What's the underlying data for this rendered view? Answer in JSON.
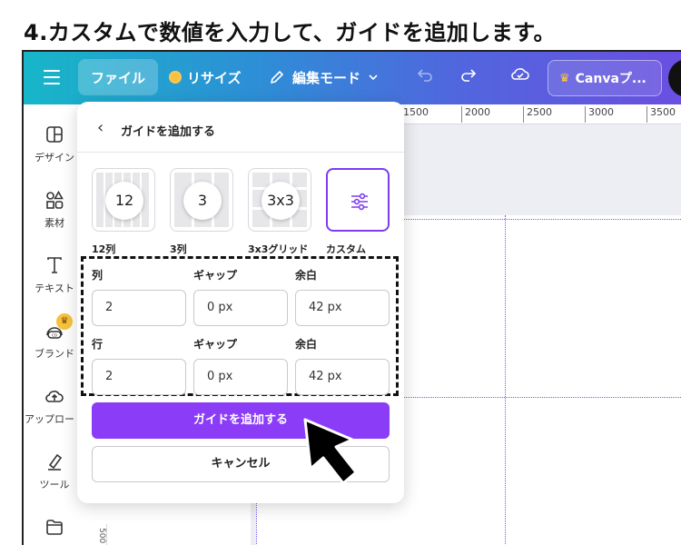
{
  "step": {
    "title": "4.カスタムで数値を入力して、ガイドを追加します。"
  },
  "topbar": {
    "file_label": "ファイル",
    "resize_label": "リサイズ",
    "edit_label": "編集モード",
    "canva_label": "Canvaプ..."
  },
  "sidebar": {
    "items": [
      {
        "label": "デザイン",
        "icon": "layout-icon"
      },
      {
        "label": "素材",
        "icon": "shapes-icon"
      },
      {
        "label": "テキスト",
        "icon": "text-icon"
      },
      {
        "label": "ブランド",
        "icon": "brand-icon"
      },
      {
        "label": "アップロード",
        "icon": "upload-icon"
      },
      {
        "label": "ツール",
        "icon": "tool-icon"
      },
      {
        "label": "",
        "icon": "folder-icon"
      }
    ]
  },
  "ruler": {
    "ticks": [
      "1500",
      "2000",
      "2500",
      "3000",
      "3500"
    ],
    "vertical_tick": "500"
  },
  "dialog": {
    "title": "ガイドを追加する",
    "presets": [
      {
        "badge": "12",
        "label": "12列"
      },
      {
        "badge": "3",
        "label": "3列"
      },
      {
        "badge": "3x3",
        "label": "3x3グリッド"
      },
      {
        "badge": "",
        "label": "カスタム"
      }
    ],
    "selected_preset": "カスタム",
    "columns": {
      "label": "列",
      "gap_label": "ギャップ",
      "margin_label": "余白",
      "value": "2",
      "gap": "0 px",
      "margin": "42 px"
    },
    "rows": {
      "label": "行",
      "gap_label": "ギャップ",
      "margin_label": "余白",
      "value": "2",
      "gap": "0 px",
      "margin": "42 px"
    },
    "add_button": "ガイドを追加する",
    "cancel_button": "キャンセル"
  },
  "colors": {
    "accent": "#8b3cf7",
    "topbar_start": "#17b6c8",
    "topbar_end": "#6a4fe0",
    "guide": "#7a5cf0"
  }
}
